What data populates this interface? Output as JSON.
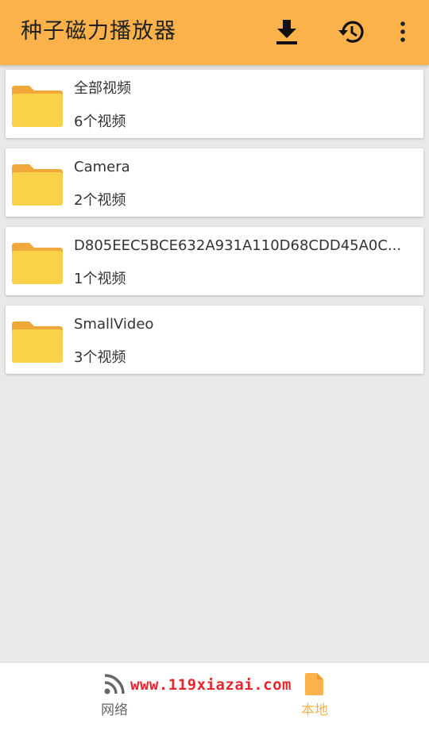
{
  "app": {
    "title": "种子磁力播放器"
  },
  "toolbar": {
    "icons": [
      "download-icon",
      "history-icon",
      "more-vert-icon"
    ]
  },
  "folders": [
    {
      "name": "全部视频",
      "count": "6个视频"
    },
    {
      "name": "Camera",
      "count": "2个视频"
    },
    {
      "name": "D805EEC5BCE632A931A110D68CDD45A0C...",
      "count": "1个视频"
    },
    {
      "name": "SmallVideo",
      "count": "3个视频"
    }
  ],
  "bottom_nav": {
    "items": [
      {
        "label": "网络",
        "icon": "rss-feed-icon",
        "active": false
      },
      {
        "label": "本地",
        "icon": "file-icon",
        "active": true
      }
    ]
  },
  "watermark": "www.119xiazai.com",
  "colors": {
    "accent": "#fbb24a",
    "folder": "#f9d24a",
    "folder_tab": "#f0a83a",
    "inactive": "#666666",
    "watermark": "#e8262f"
  }
}
